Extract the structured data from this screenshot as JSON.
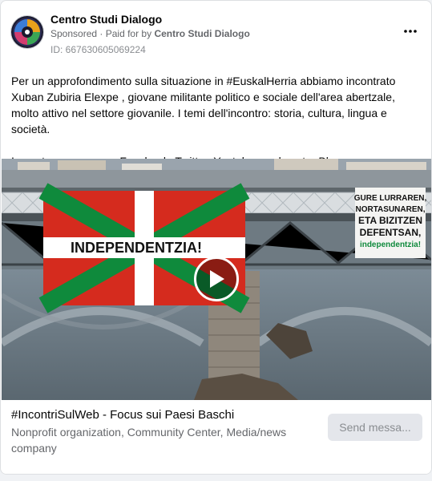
{
  "post": {
    "page_name": "Centro Studi Dialogo",
    "sponsored_label": "Sponsored",
    "paid_prefix": "Paid for by",
    "paid_by": "Centro Studi Dialogo",
    "id_text": "ID: 667630605069224",
    "body_paragraph_1": "Per un approfondimento sulla situazione in #EuskalHerria abbiamo incontrato Xuban Zubiria Elexpe , giovane militante politico e sociale dell'area abertzale, molto attivo nel settore giovanile. I temi dell'incontro: storia, cultura, lingua e società.",
    "body_paragraph_2": "In contemporanea su Facebook, Twitter, Youtube e sul nostro Blog."
  },
  "media": {
    "flag_text": "INDEPENDENTZIA!",
    "banner_lines": [
      "GURE LURRAREN,",
      "NORTASUNAREN,",
      "ETA BIZITZEN",
      "DEFENTSAN,",
      "independentzia!"
    ]
  },
  "footer": {
    "title": "#IncontriSulWeb - Focus sui Paesi Baschi",
    "description": "Nonprofit organization, Community Center, Media/news company",
    "send_button_label": "Send messa..."
  },
  "colors": {
    "flag_red": "#d52b1e",
    "flag_green": "#0f8a3c",
    "water": "#6c7880"
  }
}
